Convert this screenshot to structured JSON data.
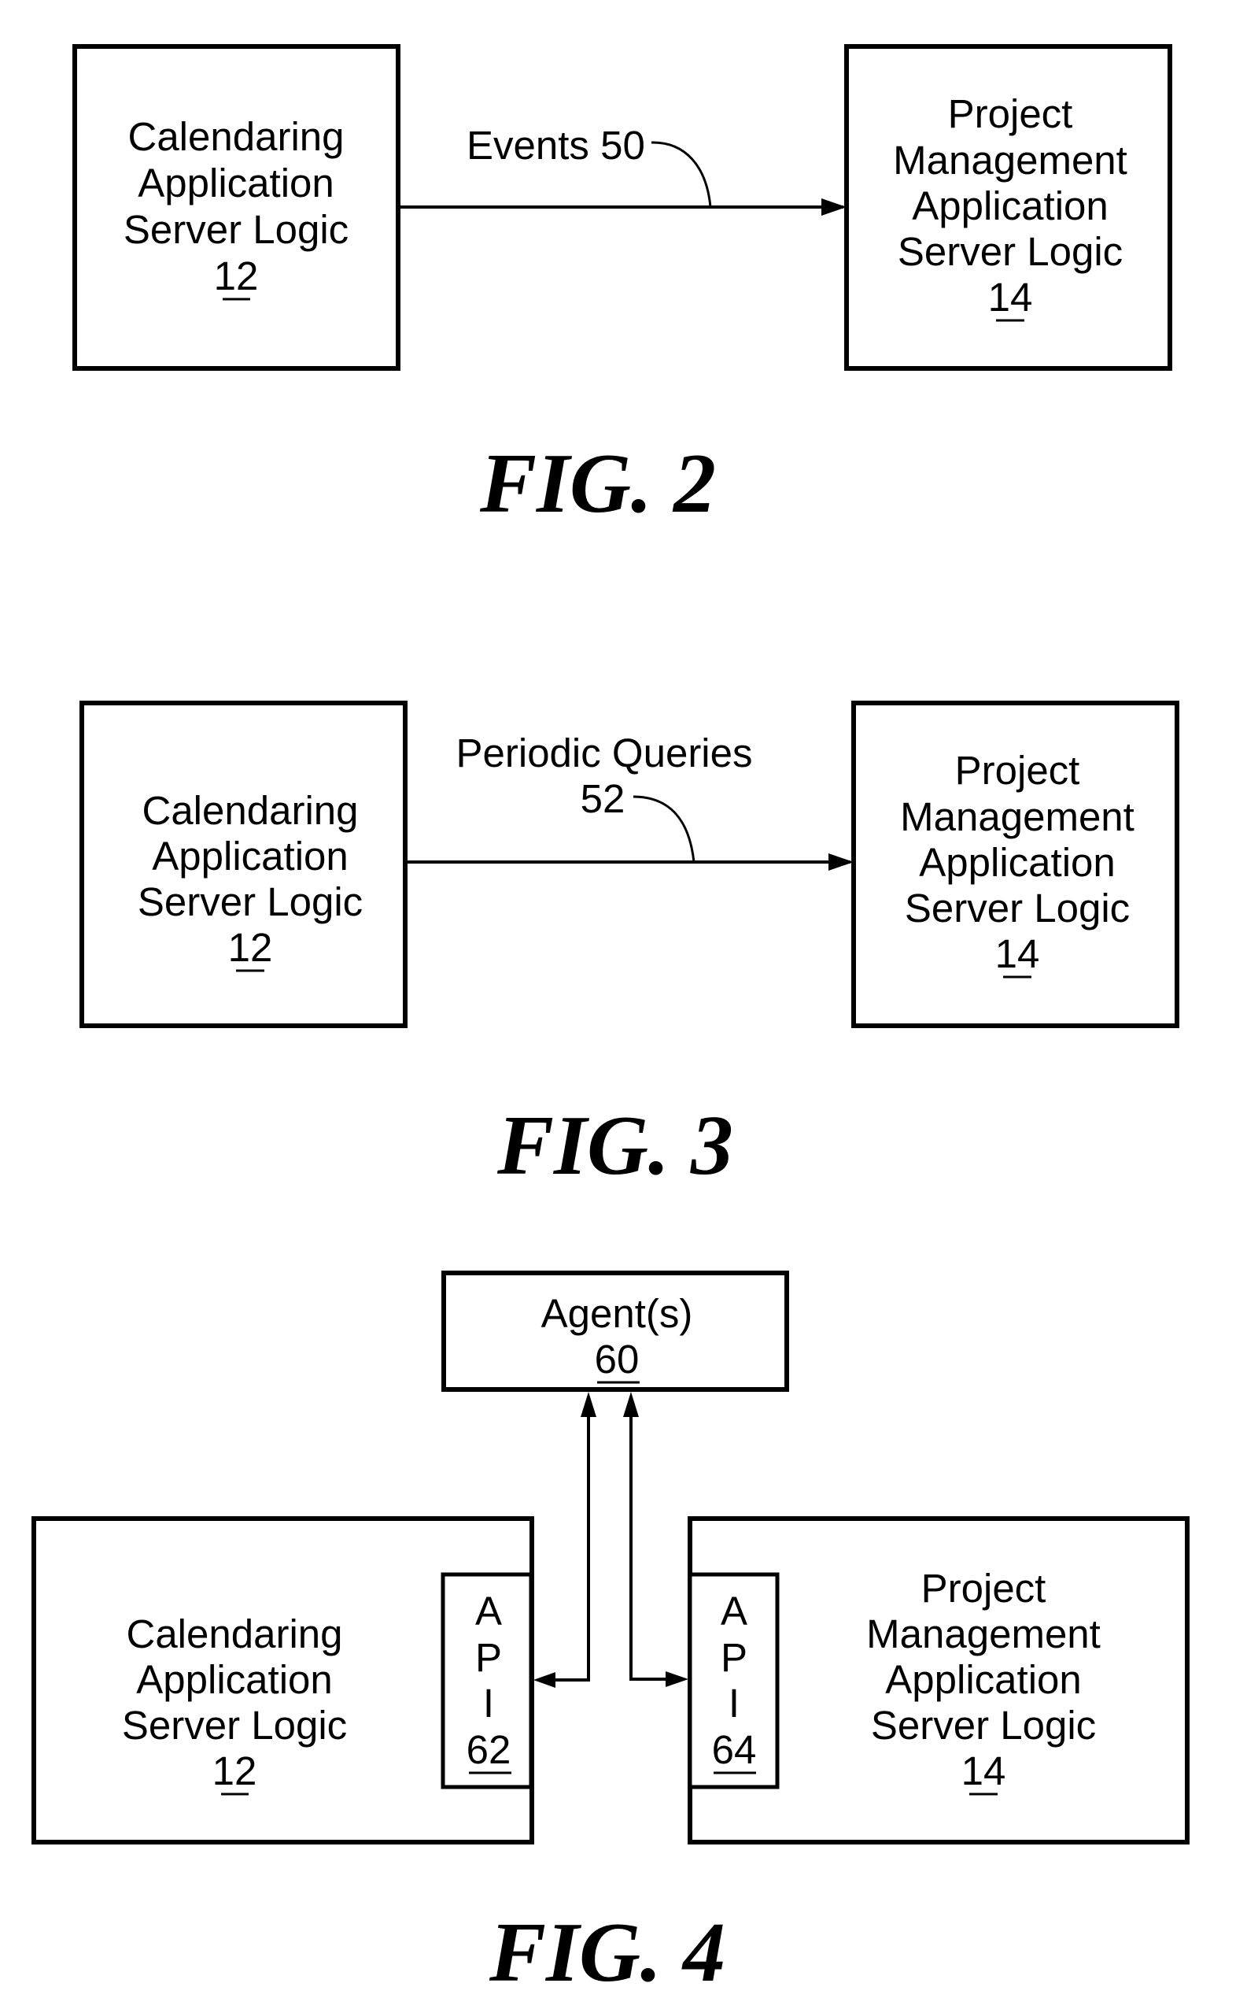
{
  "figures": [
    {
      "caption": "FIG. 2",
      "left_box": {
        "lines": [
          "Calendaring",
          "Application",
          "Server Logic"
        ],
        "ref": "12"
      },
      "right_box": {
        "lines": [
          "Project",
          "Management",
          "Application",
          "Server Logic"
        ],
        "ref": "14"
      },
      "connector": {
        "lines": [
          "Events 50"
        ],
        "direction": "left-to-right"
      }
    },
    {
      "caption": "FIG. 3",
      "left_box": {
        "lines": [
          "Calendaring",
          "Application",
          "Server Logic"
        ],
        "ref": "12"
      },
      "right_box": {
        "lines": [
          "Project",
          "Management",
          "Application",
          "Server Logic"
        ],
        "ref": "14"
      },
      "connector": {
        "lines": [
          "Periodic Queries",
          "52"
        ],
        "direction": "left-to-right"
      }
    },
    {
      "caption": "FIG. 4",
      "agent_box": {
        "lines": [
          "Agent(s)"
        ],
        "ref": "60"
      },
      "left_box": {
        "lines": [
          "Calendaring",
          "Application",
          "Server Logic"
        ],
        "ref": "12"
      },
      "left_api": {
        "letters": [
          "A",
          "P",
          "I"
        ],
        "ref": "62"
      },
      "right_box": {
        "lines": [
          "Project",
          "Management",
          "Application",
          "Server Logic"
        ],
        "ref": "14"
      },
      "right_api": {
        "letters": [
          "A",
          "P",
          "I"
        ],
        "ref": "64"
      },
      "connections": [
        "Agent(s) 60 <-> API 62",
        "Agent(s) 60 <-> API 64"
      ]
    }
  ]
}
